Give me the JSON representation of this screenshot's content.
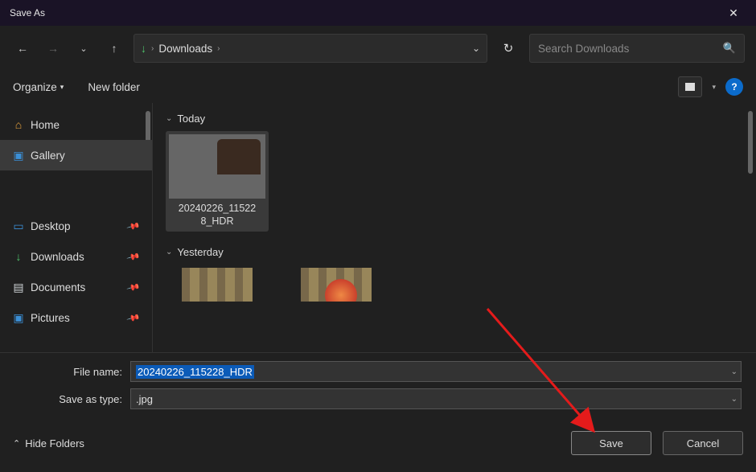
{
  "titlebar": {
    "title": "Save As"
  },
  "nav": {
    "location": "Downloads",
    "search_placeholder": "Search Downloads"
  },
  "toolbar": {
    "organize": "Organize",
    "newfolder": "New folder"
  },
  "sidebar": {
    "top": [
      {
        "label": "Home",
        "icon": "🏠"
      },
      {
        "label": "Gallery",
        "icon": "🖼"
      }
    ],
    "pinned": [
      {
        "label": "Desktop",
        "icon": "🖥"
      },
      {
        "label": "Downloads",
        "icon": "↓"
      },
      {
        "label": "Documents",
        "icon": "📄"
      },
      {
        "label": "Pictures",
        "icon": "🖼"
      }
    ]
  },
  "content": {
    "groups": [
      {
        "label": "Today",
        "items": [
          {
            "caption": "20240226_11522\n8_HDR"
          }
        ]
      },
      {
        "label": "Yesterday",
        "items": [
          {
            "caption": ""
          },
          {
            "caption": ""
          }
        ]
      }
    ]
  },
  "form": {
    "filename_label": "File name:",
    "filename_value": "20240226_115228_HDR",
    "type_label": "Save as type:",
    "type_value": ".jpg"
  },
  "footer": {
    "hide": "Hide Folders",
    "save": "Save",
    "cancel": "Cancel"
  },
  "help_glyph": "?"
}
